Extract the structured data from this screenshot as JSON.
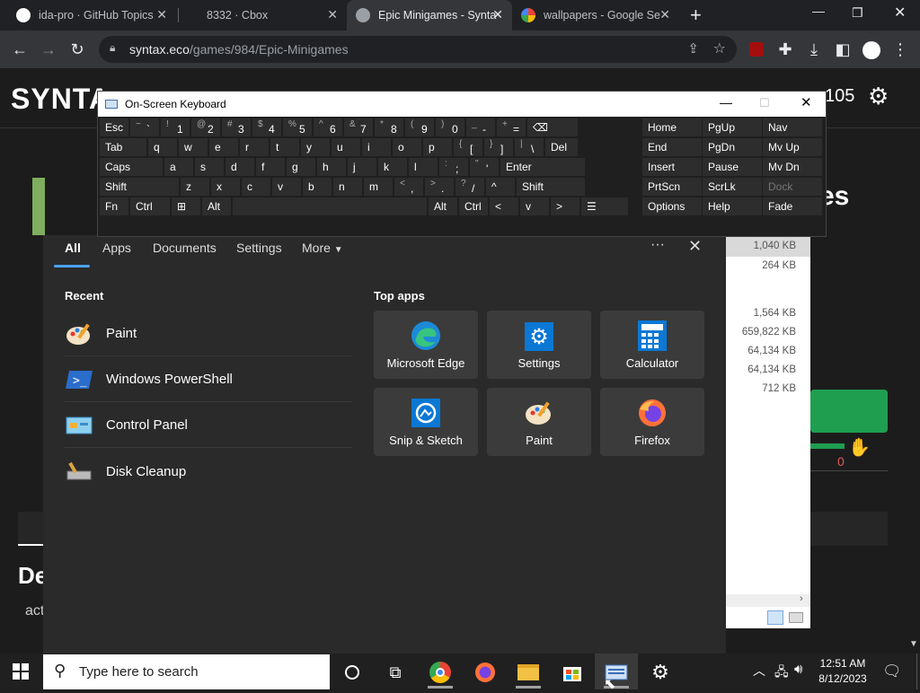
{
  "browser": {
    "tabs": [
      {
        "title": "ida-pro · GitHub Topics",
        "icon": "github-icon",
        "color": "#ffffff"
      },
      {
        "title": "8332 · Cbox",
        "icon": "none"
      },
      {
        "title": "Epic Minigames - Synta",
        "icon": "globe-icon",
        "color": "#9aa0a6"
      },
      {
        "title": "wallpapers - Google Se",
        "icon": "google-icon",
        "color": "#4285f4"
      }
    ],
    "url_host": "syntax.eco",
    "url_path": "/games/984/Epic-Minigames"
  },
  "site": {
    "logo": "SYNTA",
    "counter": "105",
    "heading_fragment": "es",
    "side_fragment": "De",
    "act_fragment": "act",
    "votes": "0"
  },
  "files": {
    "sizes": [
      "1,040 KB",
      "264 KB",
      "1,564 KB",
      "659,822 KB",
      "64,134 KB",
      "64,134 KB",
      "712 KB"
    ]
  },
  "osk": {
    "title": "On-Screen Keyboard",
    "rows": [
      [
        {
          "m": "Esc",
          "w": 34
        },
        {
          "s": "~",
          "m": "`",
          "w": 34
        },
        {
          "s": "!",
          "m": "1",
          "w": 34
        },
        {
          "s": "@",
          "m": "2",
          "w": 34
        },
        {
          "s": "#",
          "m": "3",
          "w": 34
        },
        {
          "s": "$",
          "m": "4",
          "w": 34
        },
        {
          "s": "%",
          "m": "5",
          "w": 34
        },
        {
          "s": "^",
          "m": "6",
          "w": 34
        },
        {
          "s": "&",
          "m": "7",
          "w": 34
        },
        {
          "s": "*",
          "m": "8",
          "w": 34
        },
        {
          "s": "(",
          "m": "9",
          "w": 34
        },
        {
          "s": ")",
          "m": "0",
          "w": 34
        },
        {
          "s": "_",
          "m": "-",
          "w": 34
        },
        {
          "s": "+",
          "m": "=",
          "w": 34
        },
        {
          "m": "⌫",
          "w": 58
        }
      ],
      [
        {
          "m": "Tab",
          "w": 54
        },
        {
          "m": "q",
          "w": 34
        },
        {
          "m": "w",
          "w": 34
        },
        {
          "m": "e",
          "w": 34
        },
        {
          "m": "r",
          "w": 34
        },
        {
          "m": "t",
          "w": 34
        },
        {
          "m": "y",
          "w": 34
        },
        {
          "m": "u",
          "w": 34
        },
        {
          "m": "i",
          "w": 34
        },
        {
          "m": "o",
          "w": 34
        },
        {
          "m": "p",
          "w": 34
        },
        {
          "s": "{",
          "m": "[",
          "w": 34
        },
        {
          "s": "}",
          "m": "]",
          "w": 34
        },
        {
          "s": "|",
          "m": "\\",
          "w": 34
        },
        {
          "m": "Del",
          "w": 38
        }
      ],
      [
        {
          "m": "Caps",
          "w": 72
        },
        {
          "m": "a",
          "w": 34
        },
        {
          "m": "s",
          "w": 34
        },
        {
          "m": "d",
          "w": 34
        },
        {
          "m": "f",
          "w": 34
        },
        {
          "m": "g",
          "w": 34
        },
        {
          "m": "h",
          "w": 34
        },
        {
          "m": "j",
          "w": 34
        },
        {
          "m": "k",
          "w": 34
        },
        {
          "m": "l",
          "w": 34
        },
        {
          "s": ":",
          "m": ";",
          "w": 34
        },
        {
          "s": "\"",
          "m": "'",
          "w": 34
        },
        {
          "m": "Enter",
          "w": 96
        }
      ],
      [
        {
          "m": "Shift",
          "w": 90
        },
        {
          "m": "z",
          "w": 34
        },
        {
          "m": "x",
          "w": 34
        },
        {
          "m": "c",
          "w": 34
        },
        {
          "m": "v",
          "w": 34
        },
        {
          "m": "b",
          "w": 34
        },
        {
          "m": "n",
          "w": 34
        },
        {
          "m": "m",
          "w": 34
        },
        {
          "s": "<",
          "m": ",",
          "w": 34
        },
        {
          "s": ">",
          "m": ".",
          "w": 34
        },
        {
          "s": "?",
          "m": "/",
          "w": 34
        },
        {
          "m": "^",
          "w": 34
        },
        {
          "m": "Shift",
          "w": 78
        }
      ],
      [
        {
          "m": "Fn",
          "w": 34
        },
        {
          "m": "Ctrl",
          "w": 46
        },
        {
          "m": "⊞",
          "w": 34
        },
        {
          "m": "Alt",
          "w": 34
        },
        {
          "m": "",
          "w": 218
        },
        {
          "m": "Alt",
          "w": 34
        },
        {
          "m": "Ctrl",
          "w": 34
        },
        {
          "m": "<",
          "w": 34
        },
        {
          "m": "v",
          "w": 34
        },
        {
          "m": ">",
          "w": 34
        },
        {
          "m": "☰",
          "w": 54
        }
      ]
    ],
    "nav": [
      [
        "Home",
        "PgUp",
        "Nav"
      ],
      [
        "End",
        "PgDn",
        "Mv Up"
      ],
      [
        "Insert",
        "Pause",
        "Mv Dn"
      ],
      [
        "PrtScn",
        "ScrLk",
        "Dock"
      ],
      [
        "Options",
        "Help",
        "Fade"
      ]
    ]
  },
  "start": {
    "tabs": [
      "All",
      "Apps",
      "Documents",
      "Settings",
      "More"
    ],
    "recent_label": "Recent",
    "top_label": "Top apps",
    "recent": [
      {
        "name": "Paint",
        "icon": "paint-icon"
      },
      {
        "name": "Windows PowerShell",
        "icon": "powershell-icon"
      },
      {
        "name": "Control Panel",
        "icon": "control-panel-icon"
      },
      {
        "name": "Disk Cleanup",
        "icon": "disk-cleanup-icon"
      }
    ],
    "top": [
      {
        "name": "Microsoft Edge",
        "icon": "edge-icon"
      },
      {
        "name": "Settings",
        "icon": "gear-icon"
      },
      {
        "name": "Calculator",
        "icon": "calculator-icon"
      },
      {
        "name": "Snip & Sketch",
        "icon": "snip-icon"
      },
      {
        "name": "Paint",
        "icon": "paint-icon"
      },
      {
        "name": "Firefox",
        "icon": "firefox-icon"
      }
    ]
  },
  "taskbar": {
    "search_placeholder": "Type here to search",
    "time": "12:51 AM",
    "date": "8/12/2023"
  }
}
